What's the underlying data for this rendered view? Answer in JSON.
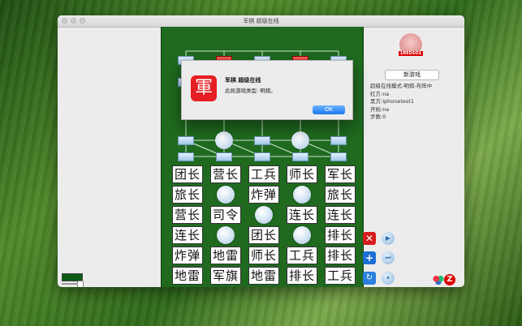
{
  "window": {
    "title": "军棋 超级在线"
  },
  "board": {
    "rows": [
      [
        "团长",
        "营长",
        "工兵",
        "师长",
        "军长"
      ],
      [
        "旅长",
        "",
        "炸弹",
        "",
        "旅长"
      ],
      [
        "营长",
        "司令",
        "",
        "连长",
        "连长"
      ],
      [
        "连长",
        "",
        "团长",
        "",
        "排长"
      ],
      [
        "炸弹",
        "地雷",
        "师长",
        "工兵",
        "排长"
      ],
      [
        "地雷",
        "军旗",
        "地雷",
        "排长",
        "工兵"
      ]
    ]
  },
  "sidebar": {
    "avatar_label": "1REDSO1",
    "new_game_label": "新游戏",
    "info": [
      "超级在线模式-明棋-布阵中",
      "红方:na",
      "黑方:iphonetest1",
      "开始:na",
      "步数:0"
    ]
  },
  "dialog": {
    "icon_glyph": "軍",
    "title": "军棋 超级在线",
    "message": "此局游戏类型: 明棋。",
    "ok_label": "OK"
  },
  "controls": {
    "close_glyph": "✕",
    "add_glyph": "+",
    "refresh_glyph": "↻",
    "play_glyph": "▶",
    "forward_glyph": "⏭",
    "pause_glyph": "⏸",
    "z_logo": "Z"
  },
  "colors": {
    "board_green": "#1f6a1f",
    "accent_red": "#e51f24",
    "ok_blue": "#1a78f0"
  }
}
